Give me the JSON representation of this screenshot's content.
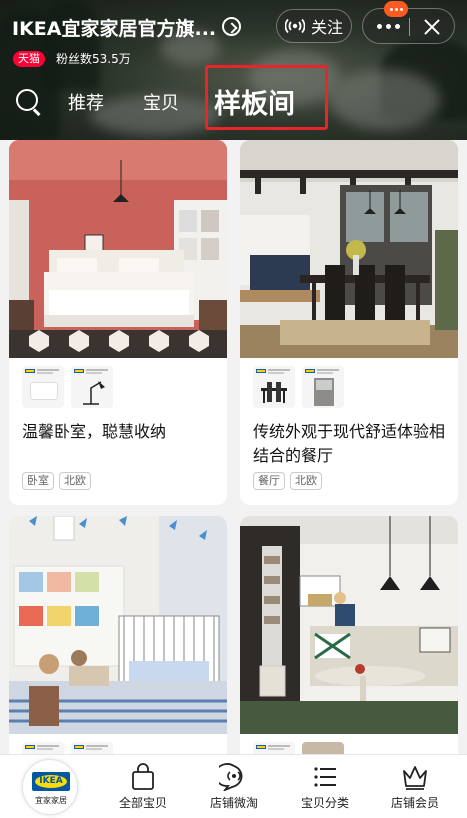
{
  "header": {
    "store_name": "IKEA宜家家居官方旗...",
    "follow_label": "关注",
    "tmall_badge": "天猫",
    "fans_text": "粉丝数53.5万"
  },
  "tabs": {
    "recommend": "推荐",
    "items": "宝贝",
    "showroom": "样板间",
    "active": "样板间"
  },
  "cards": [
    {
      "title": "温馨卧室，聪慧收纳",
      "tags": [
        "卧室",
        "北欧"
      ]
    },
    {
      "title": "传统外观于现代舒适体验相结合的餐厅",
      "tags": [
        "餐厅",
        "北欧"
      ]
    },
    {
      "title": "",
      "tags": []
    },
    {
      "title": "",
      "tags": []
    }
  ],
  "bottom_nav": {
    "store_logo_text": "IKEA",
    "store_logo_caption": "宜家家居",
    "items": [
      {
        "label": "全部宝贝",
        "icon": "shopping-bag-icon"
      },
      {
        "label": "店铺微淘",
        "icon": "weitao-chat-icon"
      },
      {
        "label": "宝贝分类",
        "icon": "category-list-icon"
      },
      {
        "label": "店铺会员",
        "icon": "crown-icon"
      }
    ]
  },
  "colors": {
    "tmall_red": "#ff0036",
    "highlight_red": "#e8262a",
    "notif_orange": "#ff5a1f",
    "ikea_blue": "#0058a3",
    "ikea_yellow": "#ffdb00"
  }
}
